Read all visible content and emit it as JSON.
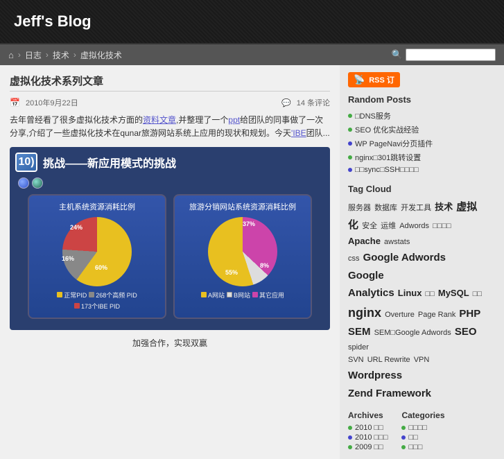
{
  "header": {
    "title": "Jeff's Blog"
  },
  "navbar": {
    "home_icon": "⌂",
    "breadcrumbs": [
      "日志",
      "技术",
      "虚拟化技术"
    ],
    "search_placeholder": ""
  },
  "post": {
    "title": "虚拟化技术系列文章",
    "date": "2010年9月22日",
    "comments": "14 条评论",
    "excerpt_parts": [
      "去年曾经看了很多虚拟化技术方面的",
      "资料",
      "文章",
      ",并整理了一个",
      "ppt",
      "给团队的同事做了一次分享,介绍了一些虚拟化技术在qunar旅游网站系统上应用的现状和规划。",
      "今天",
      "IBE",
      "团队"
    ],
    "excerpt_text": "去年曾经看了很多虚拟化技术方面的资料文章，并整理了一个ppt给团队的同事做了一次分享,介绍了一些虚拟化技术在qunar旅游网站系统上应用的现状和规划。今天 IBE 团队...",
    "slide_number": "10)",
    "slide_title": "挑战——新应用模式的挑战",
    "caption": "加强合作，实现双赢",
    "chart1": {
      "title": "主机系统资源消耗比例",
      "segments": [
        {
          "label": "正常PID",
          "pct": "60%",
          "color": "#e8c020"
        },
        {
          "label": "268个高频 PID",
          "pct": "16%",
          "color": "#888888"
        },
        {
          "label": "173个IBE PID",
          "pct": "24%",
          "color": "#cc4444"
        }
      ]
    },
    "chart2": {
      "title": "旅游分销网站系统资源消耗比例",
      "segments": [
        {
          "label": "A网站",
          "pct": "55%",
          "color": "#e8c020"
        },
        {
          "label": "B网站",
          "pct": "8%",
          "color": "#dddddd"
        },
        {
          "label": "其它应用",
          "pct": "37%",
          "color": "#cc44aa"
        }
      ]
    }
  },
  "sidebar": {
    "rss_label": "RSS 订",
    "random_posts_title": "Random Posts",
    "random_posts": [
      {
        "label": "□DNS服务",
        "color": "green"
      },
      {
        "label": "SEO 优化实战经验",
        "color": "green"
      },
      {
        "label": "WP PageNavi分页插件",
        "color": "blue"
      },
      {
        "label": "nginx□301跳转设置",
        "color": "green"
      },
      {
        "label": "□□sync□SSH□□□□",
        "color": "blue"
      }
    ],
    "tag_cloud_title": "Tag Cloud",
    "tags": [
      {
        "text": "服务器",
        "size": "small"
      },
      {
        "text": "数据库",
        "size": "small"
      },
      {
        "text": "开发工具",
        "size": "small"
      },
      {
        "text": "技术",
        "size": "medium"
      },
      {
        "text": "虚拟化",
        "size": "large"
      },
      {
        "text": "安全",
        "size": "small"
      },
      {
        "text": "运维",
        "size": "small"
      },
      {
        "text": "Adwords",
        "size": "small"
      },
      {
        "text": "□□□□",
        "size": "small"
      },
      {
        "text": "Apache",
        "size": "medium"
      },
      {
        "text": "awstats",
        "size": "small"
      },
      {
        "text": "css",
        "size": "small"
      },
      {
        "text": "Google Adwords",
        "size": "large"
      },
      {
        "text": "Google Analytics",
        "size": "large"
      },
      {
        "text": "Linux",
        "size": "medium"
      },
      {
        "text": "□□",
        "size": "small"
      },
      {
        "text": "MySQL",
        "size": "medium"
      },
      {
        "text": "□□",
        "size": "small"
      },
      {
        "text": "nginx",
        "size": "large"
      },
      {
        "text": "Overture",
        "size": "small"
      },
      {
        "text": "Page Rank",
        "size": "small"
      },
      {
        "text": "PHP",
        "size": "large"
      },
      {
        "text": "SEM",
        "size": "large"
      },
      {
        "text": "SEM□Google Adwords",
        "size": "small"
      },
      {
        "text": "SEO",
        "size": "large"
      },
      {
        "text": "spider",
        "size": "small"
      },
      {
        "text": "SVN",
        "size": "small"
      },
      {
        "text": "URL Rewrite",
        "size": "small"
      },
      {
        "text": "VPN",
        "size": "small"
      },
      {
        "text": "Wordpress",
        "size": "large"
      },
      {
        "text": "Zend Framework",
        "size": "large"
      }
    ],
    "archives_title": "Archives",
    "archives": [
      {
        "year": "2010",
        "label": "□□"
      },
      {
        "year": "2010",
        "label": "□□□"
      },
      {
        "year": "2009",
        "label": "□□"
      }
    ],
    "categories_title": "Categories",
    "categories": [
      {
        "label": "□□□□"
      },
      {
        "label": "□□"
      },
      {
        "label": "□□□"
      }
    ]
  }
}
